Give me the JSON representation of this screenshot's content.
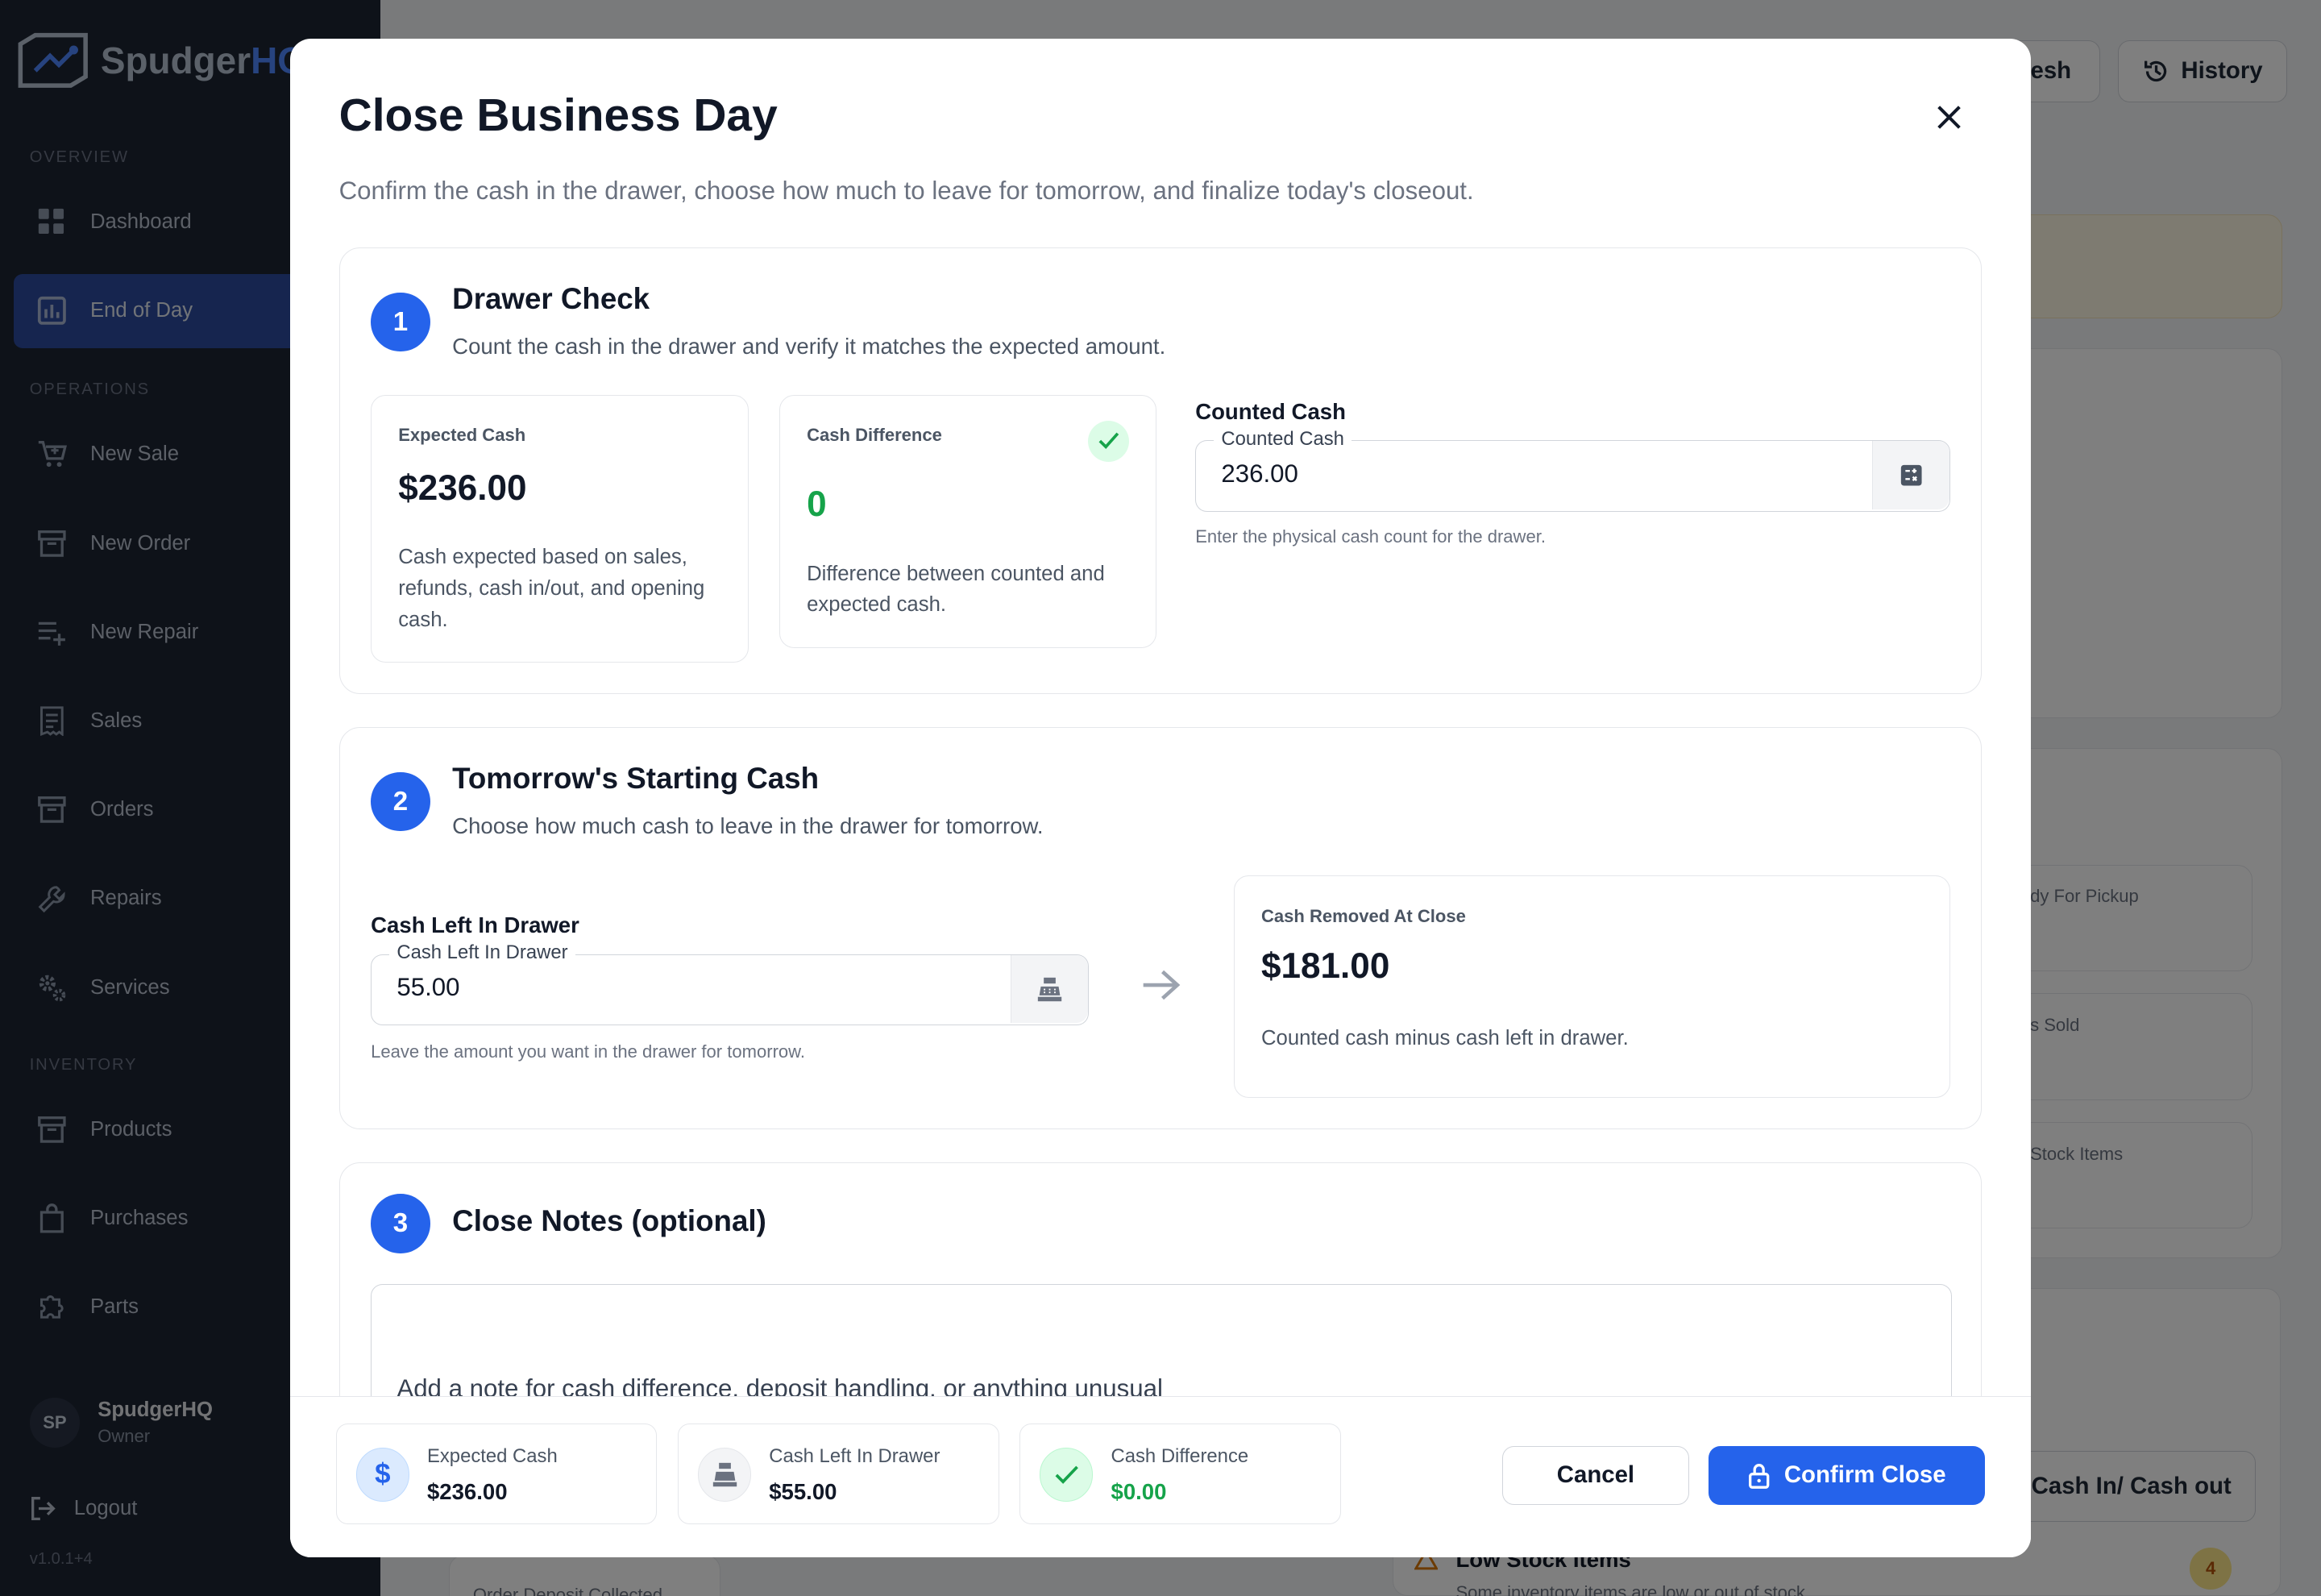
{
  "app": {
    "logo_prefix": "Spudger",
    "logo_suffix": "HQ",
    "version": "v1.0.1+4"
  },
  "sidebar": {
    "sections": [
      "OVERVIEW",
      "OPERATIONS",
      "INVENTORY"
    ],
    "items": [
      {
        "label": "Dashboard",
        "icon": "grid-icon"
      },
      {
        "label": "End of Day",
        "icon": "bar-chart-icon",
        "active": true
      },
      {
        "label": "New Sale",
        "icon": "cart-plus-icon"
      },
      {
        "label": "New Order",
        "icon": "archive-icon"
      },
      {
        "label": "New Repair",
        "icon": "playlist-add-icon"
      },
      {
        "label": "Sales",
        "icon": "receipt-icon"
      },
      {
        "label": "Orders",
        "icon": "archive-icon"
      },
      {
        "label": "Repairs",
        "icon": "wrench-icon"
      },
      {
        "label": "Services",
        "icon": "gears-icon"
      },
      {
        "label": "Products",
        "icon": "archive-icon"
      },
      {
        "label": "Purchases",
        "icon": "bag-icon"
      },
      {
        "label": "Parts",
        "icon": "puzzle-icon"
      }
    ],
    "user": {
      "initials": "SP",
      "name": "SpudgerHQ",
      "role": "Owner"
    },
    "logout_label": "Logout"
  },
  "background": {
    "refresh_label": "resh",
    "history_label": "History",
    "ready_pickup": "dy For Pickup",
    "items_sold": "s Sold",
    "stock_items": "Stock Items",
    "cash_inout": "d Cash In/ Cash out",
    "low_stock_title": "Low Stock Items",
    "low_stock_sub": "Some inventory items are low or out of stock.",
    "low_stock_count": "4",
    "order_deposit": "Order Deposit Collected"
  },
  "modal": {
    "title": "Close Business Day",
    "subtitle": "Confirm the cash in the drawer, choose how much to leave for tomorrow, and finalize today's closeout.",
    "step1": {
      "number": "1",
      "title": "Drawer Check",
      "desc": "Count the cash in the drawer and verify it matches the expected amount.",
      "expected": {
        "label": "Expected Cash",
        "value": "$236.00",
        "desc": "Cash expected based on sales, refunds, cash in/out, and opening cash."
      },
      "difference": {
        "label": "Cash Difference",
        "value": "0",
        "desc": "Difference between counted and expected cash."
      },
      "counted": {
        "label": "Counted Cash",
        "legend": "Counted Cash",
        "value": "236.00",
        "help": "Enter the physical cash count for the drawer."
      }
    },
    "step2": {
      "number": "2",
      "title": "Tomorrow's Starting Cash",
      "desc": "Choose how much cash to leave in the drawer for tomorrow.",
      "left": {
        "label": "Cash Left In Drawer",
        "legend": "Cash Left In Drawer",
        "value": "55.00",
        "help": "Leave the amount you want in the drawer for tomorrow."
      },
      "removed": {
        "label": "Cash Removed At Close",
        "value": "$181.00",
        "desc": "Counted cash minus cash left in drawer."
      }
    },
    "step3": {
      "number": "3",
      "title": "Close Notes (optional)",
      "placeholder": "Add a note for cash difference, deposit handling, or anything unusual"
    },
    "footer": {
      "expected": {
        "label": "Expected Cash",
        "value": "$236.00"
      },
      "left": {
        "label": "Cash Left In Drawer",
        "value": "$55.00"
      },
      "difference": {
        "label": "Cash Difference",
        "value": "$0.00"
      },
      "cancel_label": "Cancel",
      "confirm_label": "Confirm Close"
    }
  },
  "colors": {
    "primary": "#2563eb",
    "success": "#16a34a",
    "sidebar_bg": "#1d2433"
  }
}
